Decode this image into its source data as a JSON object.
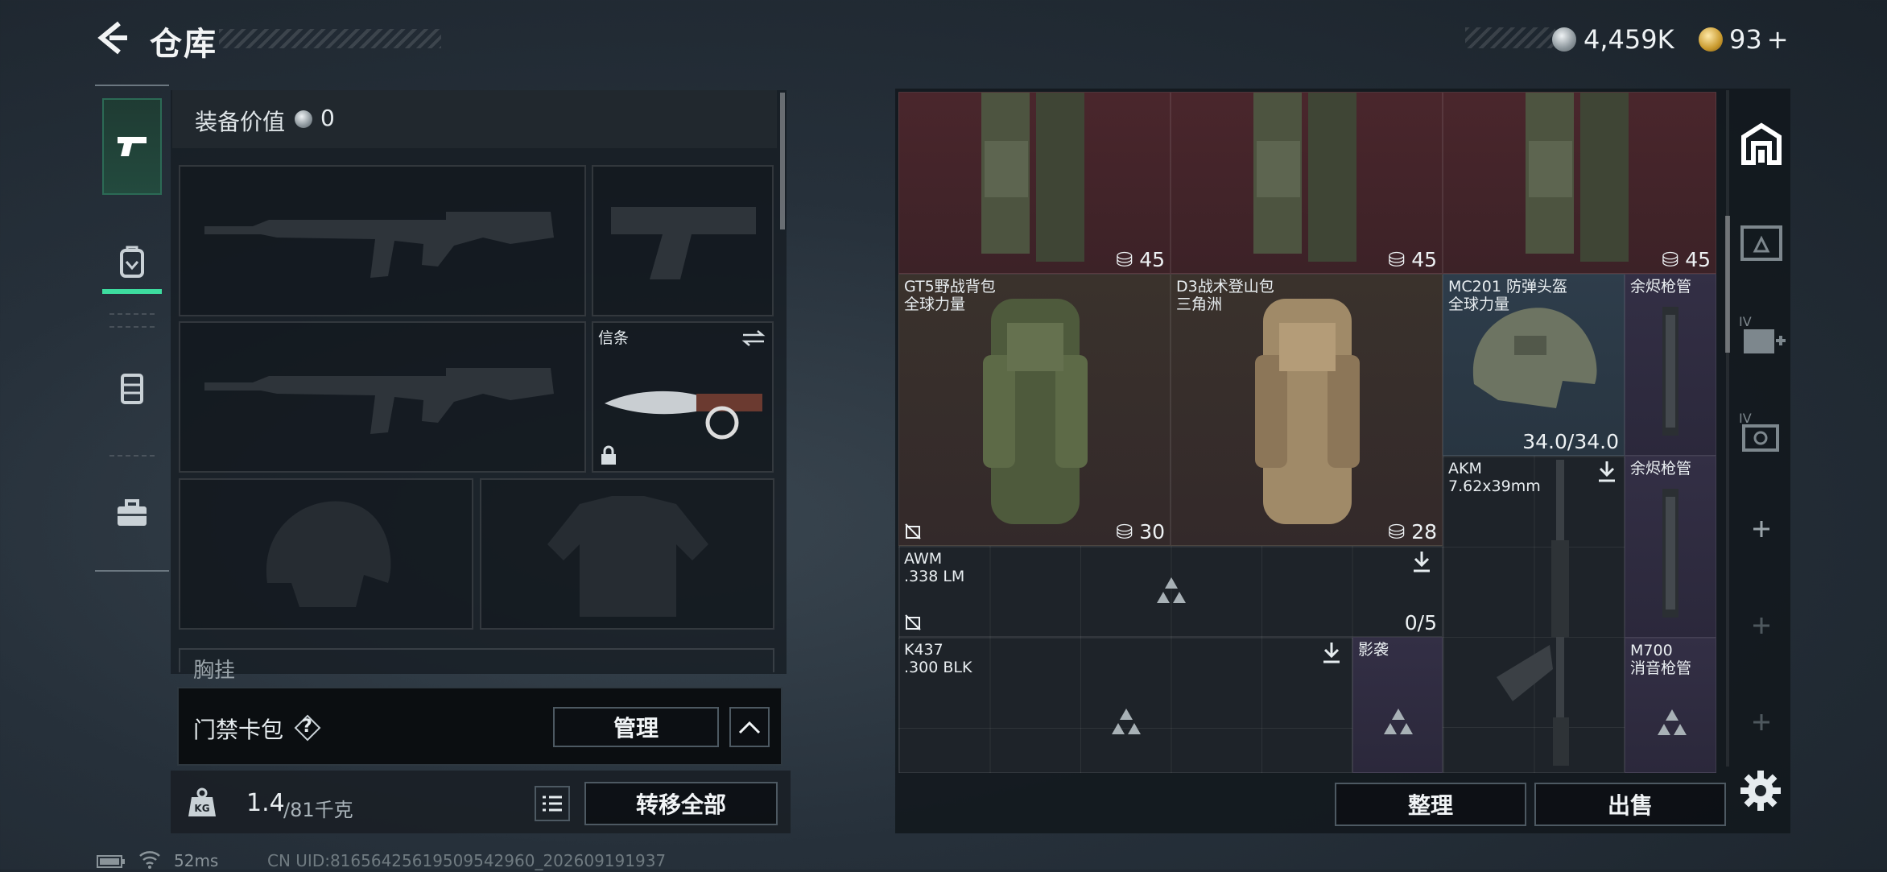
{
  "header": {
    "title": "仓库",
    "silver": "4,459K",
    "gold": "93",
    "gold_plus": "+"
  },
  "left_nav": [
    "weapon",
    "backpack",
    "vest",
    "case"
  ],
  "equip": {
    "label": "装备价值",
    "value": "0"
  },
  "slots": {
    "secret_label": "信条",
    "chest_label": "胸挂"
  },
  "keycard": {
    "label": "门禁卡包",
    "help": "?",
    "manage": "管理"
  },
  "weight": {
    "current": "1.4",
    "max": "/81千克"
  },
  "transfer_all": "转移全部",
  "status": {
    "ping": "52ms",
    "uid": "CN UID:81656425619509542960_202609191937"
  },
  "items": [
    {
      "name": "",
      "count": "45"
    },
    {
      "name": "",
      "count": "45"
    },
    {
      "name": "",
      "count": "45"
    },
    {
      "name": "GT5野战背包",
      "sub": "全球力量",
      "count": "30"
    },
    {
      "name": "D3战术登山包",
      "sub": "三角洲",
      "count": "28"
    },
    {
      "name": "MC201 防弹头盔",
      "sub": "全球力量",
      "durability": "34.0/34.0"
    },
    {
      "name": "余烬枪管"
    },
    {
      "name": "AKM",
      "sub": "7.62x39mm"
    },
    {
      "name": "余烬枪管"
    },
    {
      "name": "AWM",
      "sub": ".338 LM",
      "count": "0/5"
    },
    {
      "name": "K437",
      "sub": ".300 BLK"
    },
    {
      "name": "影袭"
    },
    {
      "name": "M700",
      "sub": "消音枪管"
    }
  ],
  "actions": {
    "sort": "整理",
    "sell": "出售"
  }
}
